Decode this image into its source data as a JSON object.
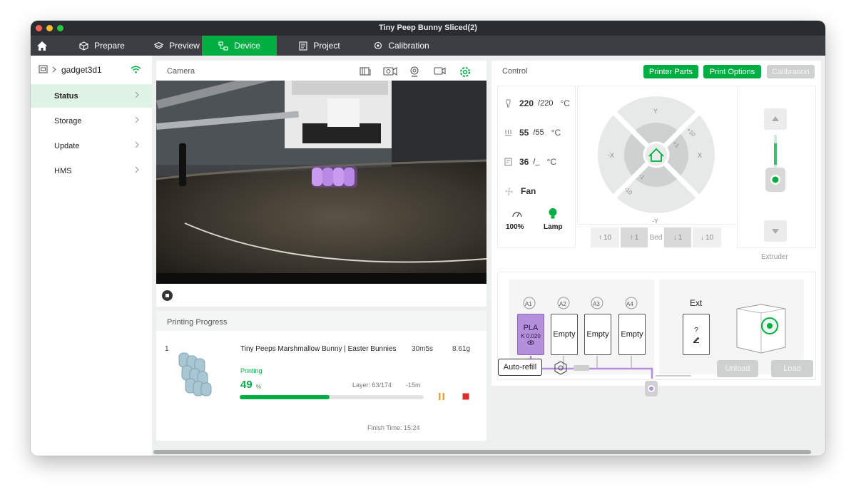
{
  "window": {
    "title": "Tiny Peep Bunny Sliced(2)"
  },
  "nav": {
    "tabs": [
      {
        "label": "Prepare",
        "icon": "cube-icon"
      },
      {
        "label": "Preview",
        "icon": "layers-icon"
      },
      {
        "label": "Device",
        "icon": "device-icon",
        "active": true
      },
      {
        "label": "Project",
        "icon": "project-icon"
      },
      {
        "label": "Calibration",
        "icon": "calibration-icon"
      }
    ],
    "active_color": "#00ae42"
  },
  "sidebar": {
    "device_name": "gadget3d1",
    "items": [
      {
        "label": "Status",
        "active": true
      },
      {
        "label": "Storage"
      },
      {
        "label": "Update"
      },
      {
        "label": "HMS"
      }
    ]
  },
  "camera": {
    "title": "Camera"
  },
  "progress": {
    "title": "Printing Progress",
    "index": "1",
    "job_name": "Tiny Peeps Marshmallow Bunny | Easter Bunnies",
    "duration": "30m5s",
    "weight": "8.61g",
    "status": "Printing",
    "percent_value": "49",
    "percent_unit": "%",
    "percent_fraction": 0.49,
    "layer": "Layer: 63/174",
    "remaining": "-15m",
    "finish_time": "Finish Time: 15:24"
  },
  "control": {
    "title": "Control",
    "buttons": {
      "printer_parts": "Printer Parts",
      "print_options": "Print Options",
      "calibration": "Calibration"
    },
    "temps": {
      "nozzle": {
        "current": "220",
        "target": "/220",
        "unit": "°C"
      },
      "bed": {
        "current": "55",
        "target": "/55",
        "unit": "°C"
      },
      "chamber": {
        "current": "36",
        "target": "/_",
        "unit": "°C"
      }
    },
    "fan_label": "Fan",
    "speed": "100%",
    "lamp_label": "Lamp",
    "jog": {
      "y_pos": "Y",
      "y_neg": "-Y",
      "x_pos": "X",
      "x_neg": "-X",
      "plus10": "+10",
      "plus1": "+1",
      "minus1": "-1",
      "minus10": "-10"
    },
    "bed_controls": {
      "up10": "10",
      "up1": "1",
      "label": "Bed",
      "down1": "1",
      "down10": "10"
    },
    "extruder_label": "Extruder"
  },
  "ams": {
    "slots": [
      {
        "id": "A1",
        "material": "PLA",
        "kvalue": "K 0.020",
        "color": "#b48fdc"
      },
      {
        "id": "A2",
        "material": "Empty"
      },
      {
        "id": "A3",
        "material": "Empty"
      },
      {
        "id": "A4",
        "material": "Empty"
      }
    ],
    "ext_label": "Ext",
    "ext_slot": "?",
    "auto_refill": "Auto-refill",
    "unload": "Unload",
    "load": "Load"
  }
}
